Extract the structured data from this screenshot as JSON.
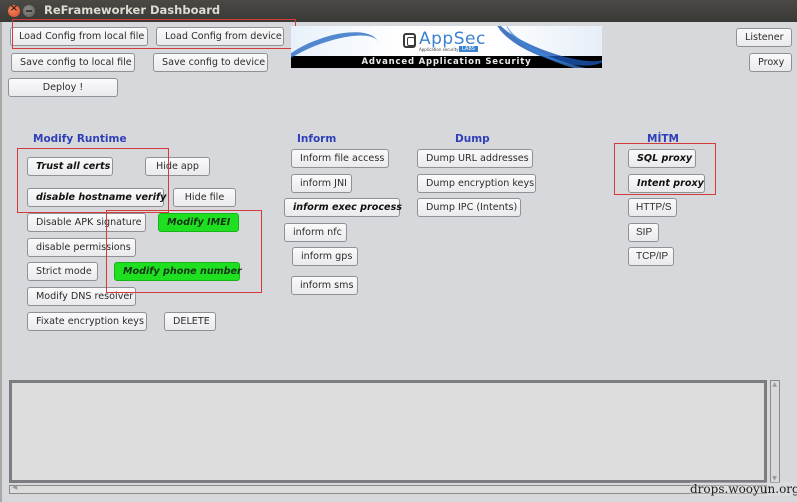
{
  "window": {
    "title": "ReFrameworker Dashboard",
    "close_glyph": "×"
  },
  "toolbar": {
    "load_local": "Load Config from local file",
    "load_device": "Load Config from device",
    "save_local": "Save config to local file",
    "save_device": "Save config to device",
    "deploy": "Deploy !",
    "listener": "Listener",
    "proxy": "Proxy"
  },
  "banner": {
    "logo_text": "AppSec",
    "logo_sub": "Application security",
    "logo_labs": "LABS",
    "tagline": "Advanced Application Security"
  },
  "sections": {
    "modify_runtime": {
      "title": "Modify Runtime",
      "buttons": [
        "Trust all certs",
        "Hide app",
        "disable hostname verify",
        "Hide file",
        "Disable APK signature",
        "Modify IMEI",
        "disable permissions",
        "Strict mode",
        "Modify phone number",
        "Modify DNS resolver",
        "Fixate encryption keys",
        "DELETE"
      ]
    },
    "inform": {
      "title": "Inform",
      "buttons": [
        "Inform file access",
        "inform JNI",
        "inform exec process",
        "inform nfc",
        "inform gps",
        "inform sms"
      ]
    },
    "dump": {
      "title": "Dump",
      "buttons": [
        "Dump URL addresses",
        "Dump encryption keys",
        "Dump IPC (Intents)"
      ]
    },
    "mitm": {
      "title": "MİTM",
      "buttons": [
        "SQL proxy",
        "Intent proxy",
        "HTTP/S",
        "SIP",
        "TCP/IP"
      ]
    }
  },
  "console": {
    "text": ""
  },
  "colors": {
    "section_title": "#2f3fb8",
    "active_green": "#1fe020",
    "highlight_red": "#d33a3a"
  },
  "watermark": "drops.wooyun.org"
}
